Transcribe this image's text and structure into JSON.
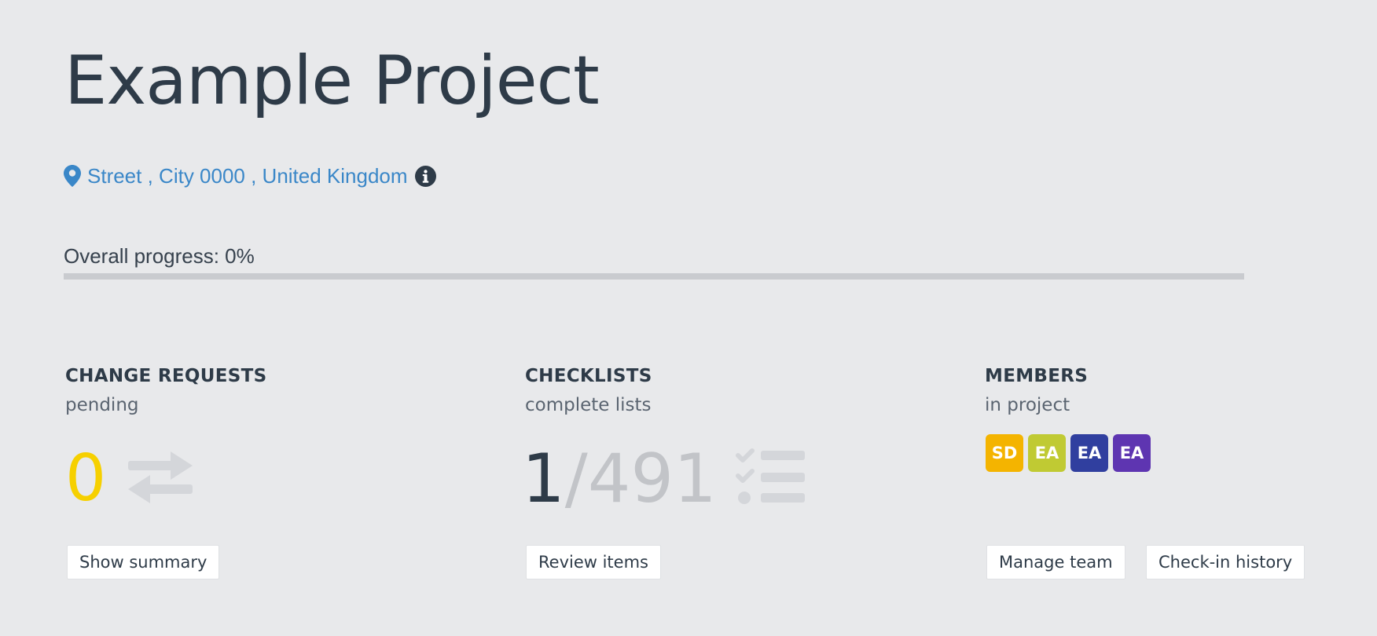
{
  "project": {
    "title": "Example Project"
  },
  "address": {
    "text": "Street , City 0000 , United Kingdom",
    "icon": "map-pin-icon",
    "info_icon": "info-icon"
  },
  "progress": {
    "label": "Overall progress: 0%",
    "value_percent": 0
  },
  "change_requests": {
    "heading": "CHANGE REQUESTS",
    "subheading": "pending",
    "count": "0",
    "icon": "swap-arrows-icon",
    "button_label": "Show summary"
  },
  "checklists": {
    "heading": "CHECKLISTS",
    "subheading": "complete lists",
    "completed": "1",
    "total": "/491",
    "icon": "checklist-icon",
    "button_label": "Review items"
  },
  "members": {
    "heading": "MEMBERS",
    "subheading": "in project",
    "avatars": [
      {
        "initials": "SD",
        "color": "#f4b400"
      },
      {
        "initials": "EA",
        "color": "#c0ca33"
      },
      {
        "initials": "EA",
        "color": "#303f9f"
      },
      {
        "initials": "EA",
        "color": "#5e35b1"
      }
    ],
    "manage_button_label": "Manage team",
    "history_button_label": "Check-in history"
  },
  "colors": {
    "background": "#e8e9eb",
    "link": "#3a87c8",
    "accent_yellow": "#f6d000",
    "text_dark": "#2e3b48"
  }
}
